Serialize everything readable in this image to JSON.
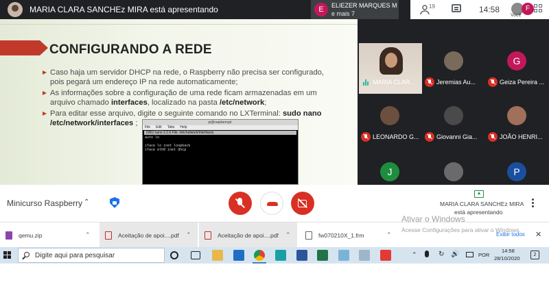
{
  "topbar": {
    "presenter_title": "MARIA CLARA SANCHEz MIRA está apresentando",
    "chat_popup": {
      "initial": "E",
      "name": "ELIEZER MARQUES M...",
      "subtitle": "e mais 7"
    },
    "participants_count": "19",
    "clock": "14:58",
    "avatar_initial": "F",
    "you_label": "Você"
  },
  "slide": {
    "title": "CONFIGURANDO A REDE",
    "bullets": [
      {
        "text": "Caso haja um servidor DHCP na rede, o Raspberry não precisa ser configurado, pois pegará um endereço IP na rede automaticamente;"
      },
      {
        "pre": "As informações sobre a configuração de uma rede ficam armazenadas em um arquivo chamado ",
        "b1": "interfaces",
        "mid": ", localizado na pasta ",
        "b2": "/etc/network",
        "post": ";"
      },
      {
        "pre": "Para editar esse arquivo, digite o seguinte comando no LXTerminal: ",
        "b1": "sudo nano /etc/network/interfaces",
        "post": " ;"
      }
    ],
    "terminal": {
      "title": "pi@raspberrypi:",
      "menu": [
        "File",
        "Edit",
        "Tabs",
        "Help"
      ],
      "status": "GNU nano 2.2.6          File: /etc/network/interfaces",
      "lines": [
        "auto lo",
        "",
        "iface lo inet loopback",
        "iface eth0 inet dhcp"
      ]
    }
  },
  "participants": [
    {
      "name": "MARIA CLAR...",
      "type": "video",
      "muted": false
    },
    {
      "name": "Jeremias Au...",
      "type": "photo",
      "muted": true,
      "color": "#7a6a5a"
    },
    {
      "name": "Geiza Pereira ...",
      "type": "letter",
      "initial": "G",
      "muted": true,
      "color": "#c2185b"
    },
    {
      "name": "LEONARDO G...",
      "type": "photo",
      "muted": true,
      "color": "#6b5040"
    },
    {
      "name": "Giovanni Gia...",
      "type": "photo",
      "muted": true,
      "color": "#4a4a4a"
    },
    {
      "name": "JOÃO HENRI...",
      "type": "photo",
      "muted": true,
      "color": "#a0705a"
    },
    {
      "name": "",
      "type": "letter",
      "initial": "J",
      "muted": false,
      "color": "#1e8e3e"
    },
    {
      "name": "",
      "type": "photo",
      "muted": false,
      "color": "#6a6a6a"
    },
    {
      "name": "",
      "type": "letter",
      "initial": "P",
      "muted": false,
      "color": "#1a4fa0"
    }
  ],
  "controls": {
    "meeting_name": "Minicurso Raspberry",
    "presenter_name": "MARIA CLARA SANCHEz MIRA",
    "presenting_label": "está apresentando"
  },
  "downloads": {
    "items": [
      {
        "name": "qemu.zip",
        "kind": "zip"
      },
      {
        "name": "Aceitação de apoi....pdf",
        "kind": "pdf"
      },
      {
        "name": "Aceitação de apoi....pdf",
        "kind": "pdf"
      },
      {
        "name": "fw070210X_1.frm",
        "kind": "doc"
      }
    ],
    "show_all": "Exibir todos",
    "watermark_title": "Ativar o Windows",
    "watermark_sub": "Acesse Configurações para ativar o Windows."
  },
  "taskbar": {
    "search_placeholder": "Digite aqui para pesquisar",
    "lang": "POR",
    "time": "14:58",
    "date": "28/10/2020",
    "notif_count": "2"
  }
}
